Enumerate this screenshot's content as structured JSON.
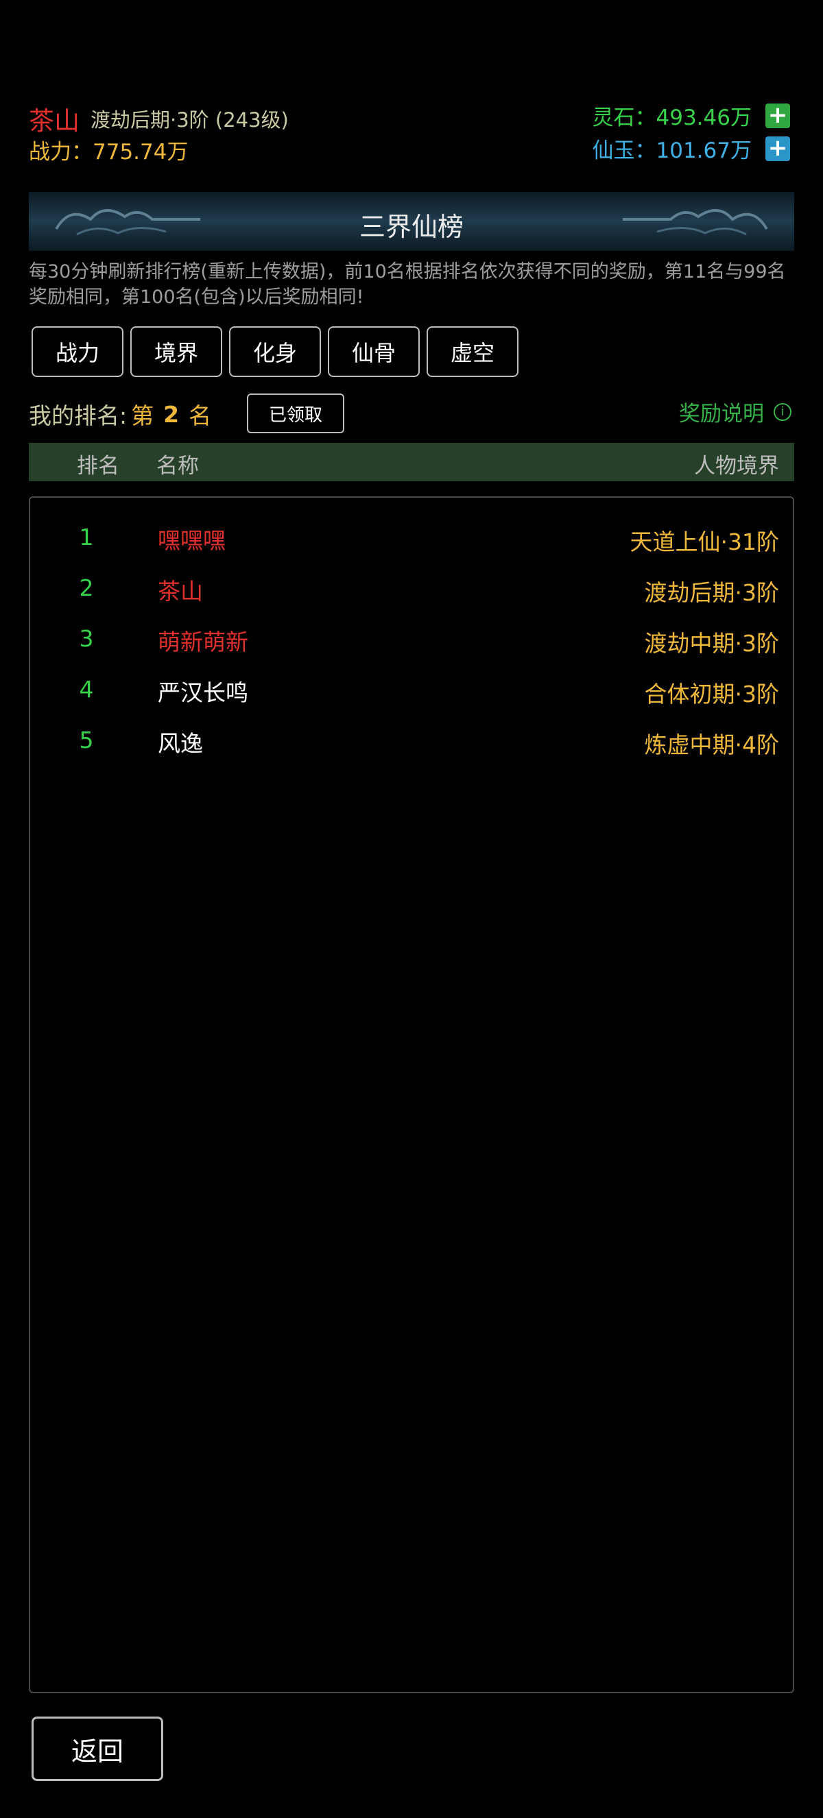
{
  "header": {
    "player_name": "茶山",
    "realm_text": "渡劫后期·3阶 (243级)",
    "power_label": "战力：",
    "power_value": "775.74万",
    "lingshi_label": "灵石：",
    "lingshi_value": "493.46万",
    "xianyu_label": "仙玉：",
    "xianyu_value": "101.67万",
    "plus_symbol": "+",
    "colors": {
      "name": "#e0302c",
      "lingshi": "#36d24a",
      "xianyu": "#3fb1e6",
      "gold": "#f0b83a"
    }
  },
  "banner": {
    "title": "三界仙榜",
    "decor_icon": "cloud-ornament"
  },
  "notice": "每30分钟刷新排行榜(重新上传数据)，前10名根据排名依次获得不同的奖励，第11名与99名奖励相同，第100名(包含)以后奖励相同!",
  "tabs": [
    {
      "label": "战力"
    },
    {
      "label": "境界"
    },
    {
      "label": "化身"
    },
    {
      "label": "仙骨"
    },
    {
      "label": "虚空"
    }
  ],
  "my_rank": {
    "label": "我的排名:",
    "prefix": "第",
    "value": "2",
    "suffix": "名",
    "claim_button": "已领取",
    "reward_info": "奖励说明",
    "info_icon": "i"
  },
  "table": {
    "headers": {
      "rank": "排名",
      "name": "名称",
      "realm": "人物境界"
    },
    "rows": [
      {
        "rank": "1",
        "name": "嘿嘿嘿",
        "realm": "天道上仙·31阶",
        "name_color": "red"
      },
      {
        "rank": "2",
        "name": "茶山",
        "realm": "渡劫后期·3阶",
        "name_color": "red"
      },
      {
        "rank": "3",
        "name": "萌新萌新",
        "realm": "渡劫中期·3阶",
        "name_color": "red"
      },
      {
        "rank": "4",
        "name": "严汉长鸣",
        "realm": "合体初期·3阶",
        "name_color": "white"
      },
      {
        "rank": "5",
        "name": "风逸",
        "realm": "炼虚中期·4阶",
        "name_color": "white"
      }
    ]
  },
  "footer": {
    "back_label": "返回"
  }
}
